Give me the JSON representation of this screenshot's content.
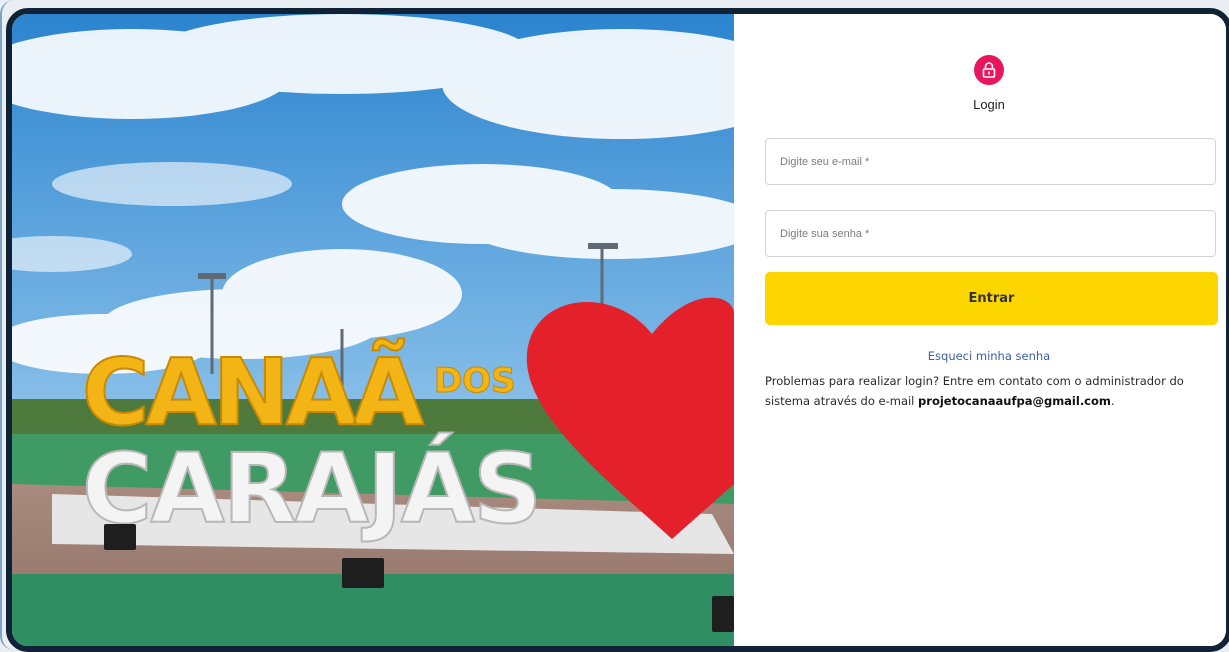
{
  "login": {
    "title": "Login",
    "icon": "lock-icon",
    "accent_color": "#e8175d",
    "email_placeholder": "Digite seu e-mail *",
    "password_placeholder": "Digite sua senha *",
    "submit_label": "Entrar",
    "submit_color": "#fdd600",
    "forgot_label": "Esqueci minha senha",
    "help_text": "Problemas para realizar login? Entre em contato com o administrador do sistema através do e-mail ",
    "help_email": "projetocanaaufpa@gmail.com",
    "help_suffix": "."
  },
  "hero": {
    "sign_line1": "CANAÃ",
    "sign_dos": "DOS",
    "sign_line2": "CARAJÁS"
  }
}
